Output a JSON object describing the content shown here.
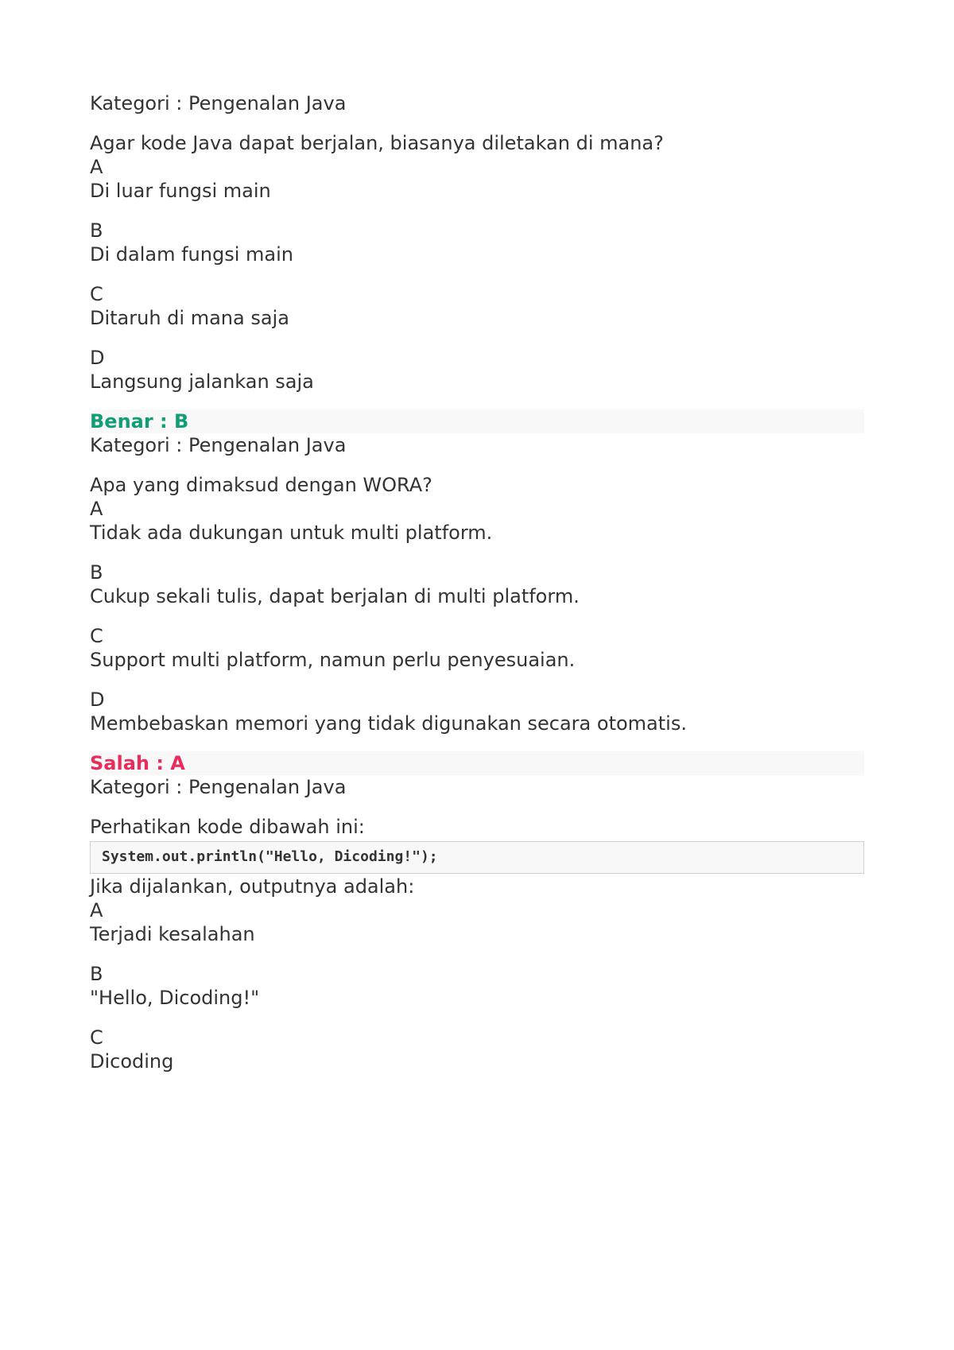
{
  "q1": {
    "category": "Kategori : Pengenalan Java",
    "question": "Agar kode Java dapat berjalan, biasanya diletakan di mana?",
    "options": {
      "A": {
        "letter": "A",
        "text": "Di luar fungsi main"
      },
      "B": {
        "letter": "B",
        "text": "Di dalam fungsi main"
      },
      "C": {
        "letter": "C",
        "text": "Ditaruh di mana saja"
      },
      "D": {
        "letter": "D",
        "text": "Langsung jalankan saja"
      }
    },
    "result": "Benar : B"
  },
  "q2": {
    "category": "Kategori : Pengenalan Java",
    "question": "Apa yang dimaksud dengan WORA?",
    "options": {
      "A": {
        "letter": "A",
        "text": "Tidak ada dukungan untuk multi platform."
      },
      "B": {
        "letter": "B",
        "text": "Cukup sekali tulis, dapat berjalan di multi platform."
      },
      "C": {
        "letter": "C",
        "text": "Support multi platform, namun perlu penyesuaian."
      },
      "D": {
        "letter": "D",
        "text": "Membebaskan memori yang tidak digunakan secara otomatis."
      }
    },
    "result": "Salah : A"
  },
  "q3": {
    "category": "Kategori : Pengenalan Java",
    "prompt": "Perhatikan kode dibawah ini:",
    "code": "System.out.println(\"Hello, Dicoding!\");",
    "followup": "Jika dijalankan, outputnya adalah:",
    "options": {
      "A": {
        "letter": "A",
        "text": "Terjadi kesalahan"
      },
      "B": {
        "letter": "B",
        "text": "\"Hello, Dicoding!\""
      },
      "C": {
        "letter": "C",
        "text": "Dicoding"
      }
    }
  }
}
